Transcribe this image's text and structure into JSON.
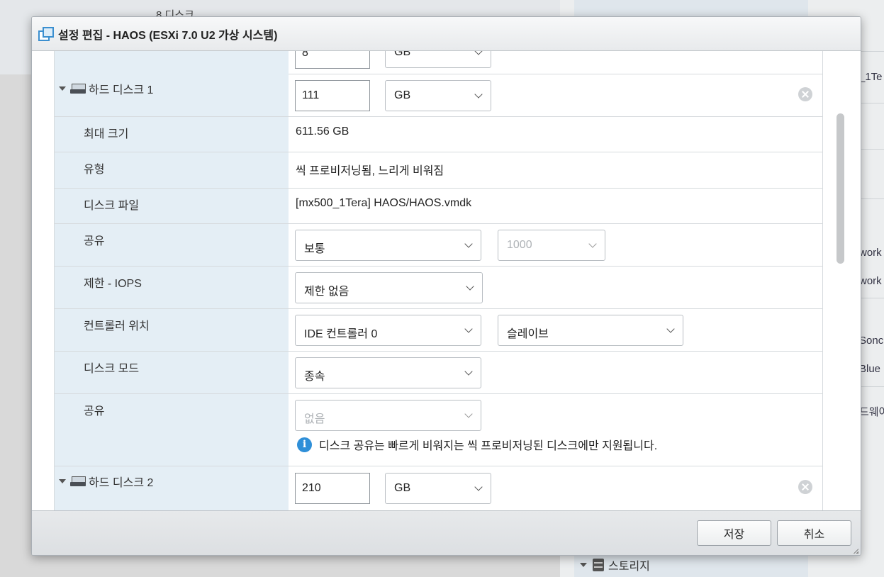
{
  "background": {
    "left_row_text": "8 디스크",
    "right_items": [
      "_1Te",
      "work",
      "work",
      "Sonc",
      "Blue",
      "드웨어"
    ],
    "storage_label": "스토리지"
  },
  "dialog": {
    "title": "설정 편집 - HAOS (ESXi 7.0 U2 가상 시스템)",
    "top_partial": {
      "size": "8",
      "unit": "GB"
    },
    "disk1": {
      "label": "하드 디스크 1",
      "size": "111",
      "unit": "GB",
      "rows": {
        "max_size_label": "최대 크기",
        "max_size_value": "611.56 GB",
        "type_label": "유형",
        "type_value": "씩 프로비저닝됨, 느리게 비워짐",
        "file_label": "디스크 파일",
        "file_value": "[mx500_1Tera] HAOS/HAOS.vmdk",
        "shares_label": "공유",
        "shares_value": "보통",
        "shares_number": "1000",
        "iops_label": "제한 - IOPS",
        "iops_value": "제한 없음",
        "controller_label": "컨트롤러 위치",
        "controller_value": "IDE 컨트롤러 0",
        "controller_slot": "슬레이브",
        "mode_label": "디스크 모드",
        "mode_value": "종속",
        "sharing_label": "공유",
        "sharing_value": "없음",
        "sharing_info": "디스크 공유는 빠르게 비워지는 씩 프로비저닝된 디스크에만 지원됩니다."
      }
    },
    "disk2": {
      "label": "하드 디스크 2",
      "size": "210",
      "unit": "GB"
    },
    "save_label": "저장",
    "cancel_label": "취소"
  }
}
